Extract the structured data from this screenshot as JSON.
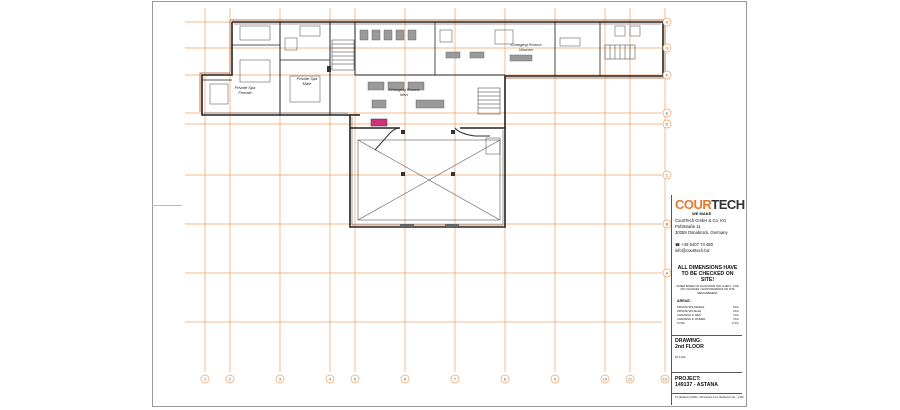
{
  "rooms": [
    {
      "id": "private-spa-female",
      "label": "Private Spa\nFemale"
    },
    {
      "id": "private-spa-male",
      "label": "Private Spa\nMale"
    },
    {
      "id": "changing-rooms-men",
      "label": "Changing Rooms\nMen"
    },
    {
      "id": "changing-rooms-women",
      "label": "Changing Rooms\nWomen"
    }
  ],
  "grid": {
    "columns": [
      "1",
      "2",
      "3",
      "4",
      "5",
      "6",
      "7",
      "8",
      "9",
      "10",
      "11",
      "12"
    ],
    "rows": [
      "H",
      "G",
      "F",
      "E",
      "D",
      "C",
      "B",
      "A"
    ]
  },
  "title_block": {
    "logo_a": "COUR",
    "logo_b": "TECH",
    "slogan": "WE MAKE",
    "address": "CourtTech GmbH & Co. KG\nPohlstraße 11\n30359 Osnabrück, Germany",
    "contact": "☎ +49 5407 73 480\ninfo@courttech.biz",
    "warning": "ALL DIMENSIONS HAVE TO BE CHECKED ON SITE!",
    "note": "OFFER BASED ON PLAN FROM THE CLIENT - FOR ANY CHANGES / SHOP DRAWINGS ON SITE MEASUREMENT",
    "areas_heading": "AREAS:",
    "areas": [
      {
        "name": "PRIVATE SPA FEMALE",
        "value": "15m²"
      },
      {
        "name": "PRIVATE SPA MALE",
        "value": "15m²"
      },
      {
        "name": "CHANGING R. MEN",
        "value": "71m²"
      },
      {
        "name": "CHANGING R. WOMEN",
        "value": "70m²"
      },
      {
        "name": "TOTAL",
        "value": "171m²"
      }
    ],
    "drawing_label": "DRAWING:",
    "drawing_value": "2nd FLOOR",
    "drawing_small": "AT 1:100",
    "project_label": "PROJECT:",
    "project_value": "149137 - ASTANA",
    "footer": "CT_Bestand_6.DWG - Dimensions to be checked on site - 1:100"
  },
  "colors": {
    "grid_line": "#f0a060",
    "wall": "#222222",
    "accent": "#e8782a",
    "magenta_bench": "#d0327a",
    "floor_outline": "#c07a4a"
  }
}
